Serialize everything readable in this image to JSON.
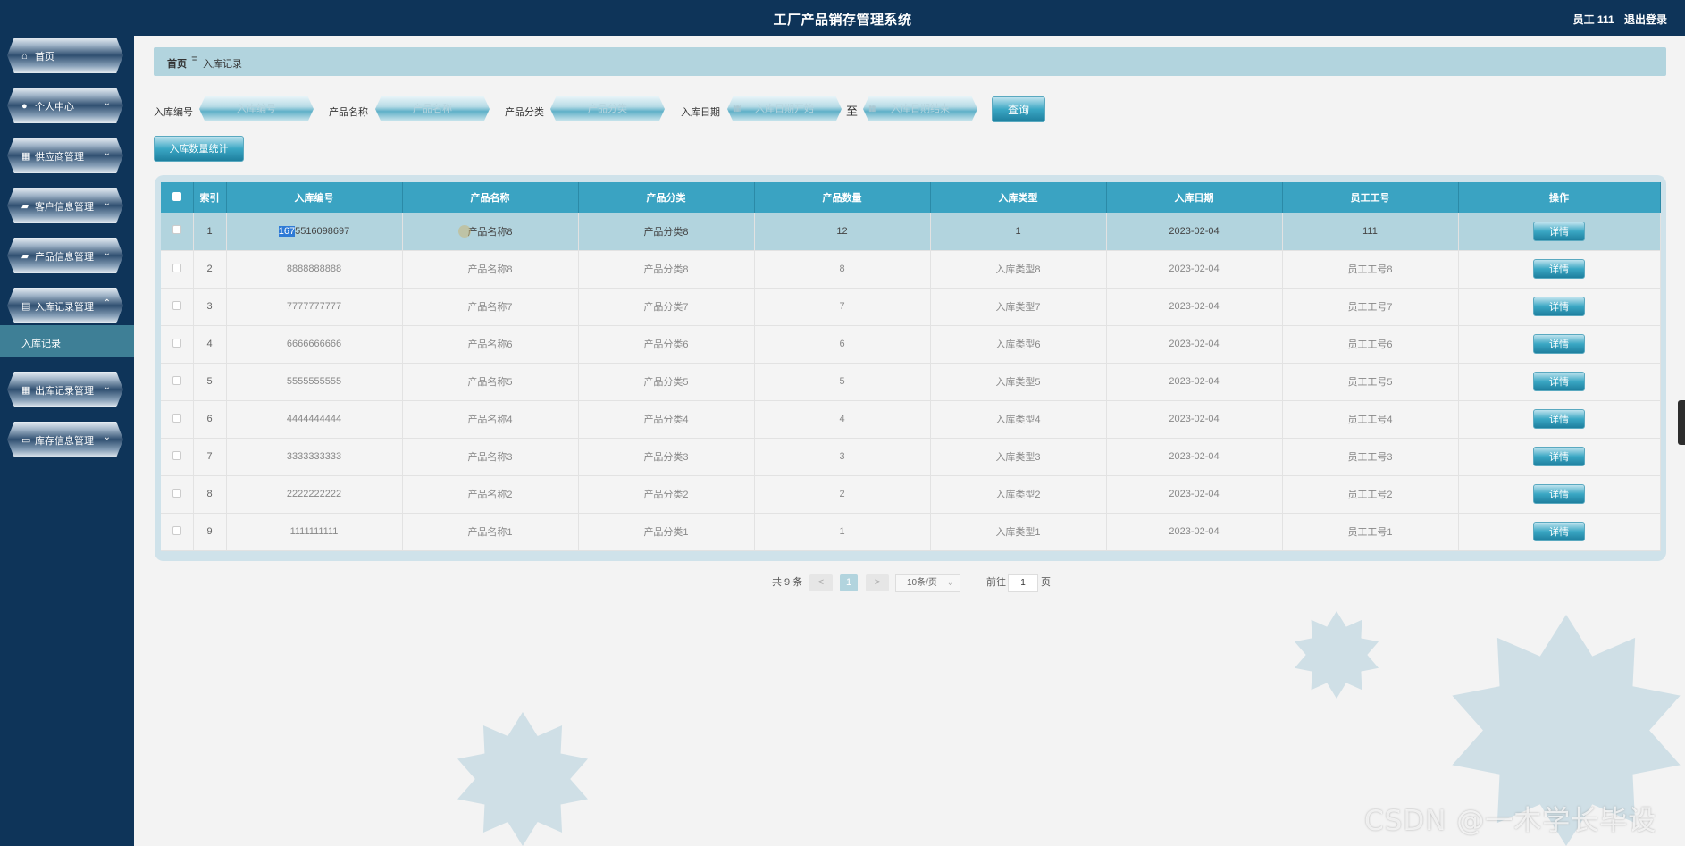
{
  "app": {
    "title": "工厂产品销存管理系统",
    "user_label": "员工 111",
    "logout_label": "退出登录"
  },
  "sidebar": {
    "items": [
      {
        "label": "首页",
        "icon": "home-icon",
        "expandable": false
      },
      {
        "label": "个人中心",
        "icon": "user-icon",
        "expandable": true
      },
      {
        "label": "供应商管理",
        "icon": "grid-icon",
        "expandable": true
      },
      {
        "label": "客户信息管理",
        "icon": "briefcase-icon",
        "expandable": true
      },
      {
        "label": "产品信息管理",
        "icon": "briefcase-icon",
        "expandable": true
      },
      {
        "label": "入库记录管理",
        "icon": "clipboard-icon",
        "expandable": true,
        "expanded": true
      },
      {
        "label": "出库记录管理",
        "icon": "grid-icon",
        "expandable": true
      },
      {
        "label": "库存信息管理",
        "icon": "monitor-icon",
        "expandable": true
      }
    ],
    "submenu_active": "入库记录"
  },
  "breadcrumb": {
    "home": "首页",
    "separator": "Ξ",
    "current": "入库记录"
  },
  "search": {
    "fields": [
      {
        "label": "入库编号",
        "placeholder": "入库编号"
      },
      {
        "label": "产品名称",
        "placeholder": "产品名称"
      },
      {
        "label": "产品分类",
        "placeholder": "产品分类"
      },
      {
        "label": "入库日期",
        "placeholder": "入库日期开始"
      }
    ],
    "to_label": "至",
    "date_end_placeholder": "入库日期结束",
    "query_label": "查询",
    "stat_label": "入库数量统计"
  },
  "table": {
    "headers": [
      "索引",
      "入库编号",
      "产品名称",
      "产品分类",
      "产品数量",
      "入库类型",
      "入库日期",
      "员工工号",
      "操作"
    ],
    "detail_label": "详情",
    "rows": [
      {
        "index": "1",
        "code_sel": "167",
        "code_rest": "5516098697",
        "name": "产品名称8",
        "category": "产品分类8",
        "qty": "12",
        "type": "1",
        "date": "2023-02-04",
        "staff": "111"
      },
      {
        "index": "2",
        "code_sel": "",
        "code_rest": "8888888888",
        "name": "产品名称8",
        "category": "产品分类8",
        "qty": "8",
        "type": "入库类型8",
        "date": "2023-02-04",
        "staff": "员工工号8"
      },
      {
        "index": "3",
        "code_sel": "",
        "code_rest": "7777777777",
        "name": "产品名称7",
        "category": "产品分类7",
        "qty": "7",
        "type": "入库类型7",
        "date": "2023-02-04",
        "staff": "员工工号7"
      },
      {
        "index": "4",
        "code_sel": "",
        "code_rest": "6666666666",
        "name": "产品名称6",
        "category": "产品分类6",
        "qty": "6",
        "type": "入库类型6",
        "date": "2023-02-04",
        "staff": "员工工号6"
      },
      {
        "index": "5",
        "code_sel": "",
        "code_rest": "5555555555",
        "name": "产品名称5",
        "category": "产品分类5",
        "qty": "5",
        "type": "入库类型5",
        "date": "2023-02-04",
        "staff": "员工工号5"
      },
      {
        "index": "6",
        "code_sel": "",
        "code_rest": "4444444444",
        "name": "产品名称4",
        "category": "产品分类4",
        "qty": "4",
        "type": "入库类型4",
        "date": "2023-02-04",
        "staff": "员工工号4"
      },
      {
        "index": "7",
        "code_sel": "",
        "code_rest": "3333333333",
        "name": "产品名称3",
        "category": "产品分类3",
        "qty": "3",
        "type": "入库类型3",
        "date": "2023-02-04",
        "staff": "员工工号3"
      },
      {
        "index": "8",
        "code_sel": "",
        "code_rest": "2222222222",
        "name": "产品名称2",
        "category": "产品分类2",
        "qty": "2",
        "type": "入库类型2",
        "date": "2023-02-04",
        "staff": "员工工号2"
      },
      {
        "index": "9",
        "code_sel": "",
        "code_rest": "1111111111",
        "name": "产品名称1",
        "category": "产品分类1",
        "qty": "1",
        "type": "入库类型1",
        "date": "2023-02-04",
        "staff": "员工工号1"
      }
    ]
  },
  "pagination": {
    "total": "共 9 条",
    "prev": "<",
    "current_page": "1",
    "next": ">",
    "page_size": "10条/页",
    "goto_prefix": "前往",
    "goto_value": "1",
    "goto_suffix": "页"
  },
  "watermark": "CSDN @一木学长毕设"
}
